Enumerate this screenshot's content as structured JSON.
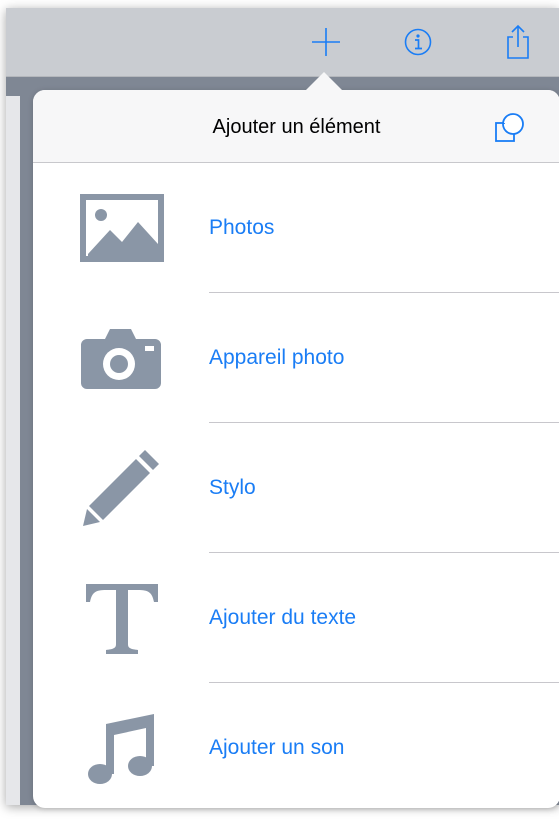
{
  "toolbar": {
    "icons": [
      "plus-icon",
      "info-icon",
      "share-icon"
    ]
  },
  "popover": {
    "title": "Ajouter un élément",
    "shapes_icon": "shapes-icon",
    "items": [
      {
        "label": "Photos",
        "icon": "photo-icon"
      },
      {
        "label": "Appareil photo",
        "icon": "camera-icon"
      },
      {
        "label": "Stylo",
        "icon": "pencil-icon"
      },
      {
        "label": "Ajouter du texte",
        "icon": "text-icon"
      },
      {
        "label": "Ajouter un son",
        "icon": "music-note-icon"
      }
    ]
  },
  "colors": {
    "accent": "#1a7df5",
    "icon_gray": "#8a96a6",
    "toolbar_bg": "#c9ccd1",
    "backdrop": "#7f8794"
  }
}
